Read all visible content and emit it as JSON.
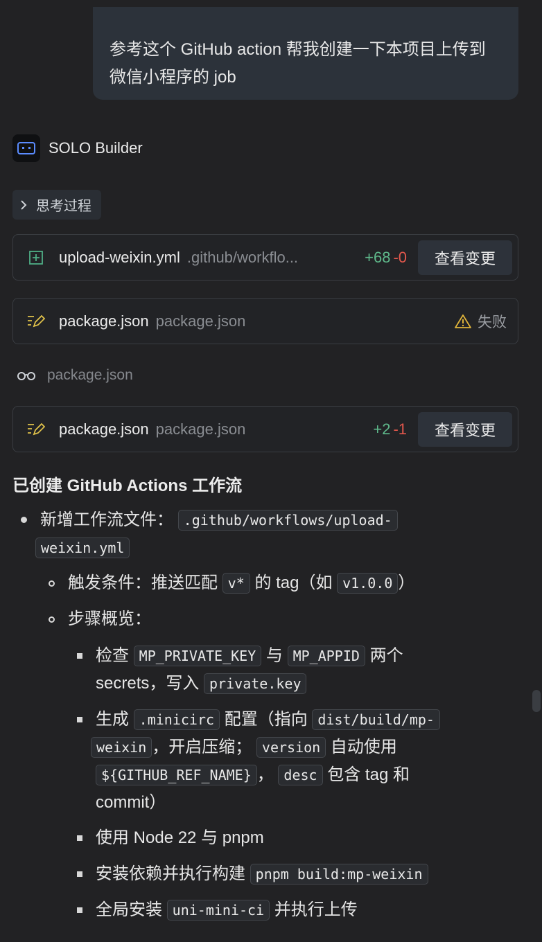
{
  "user_message": "参考这个 GitHub action 帮我创建一下本项目上传到微信小程序的 job",
  "agent": {
    "name": "SOLO Builder"
  },
  "thinking": {
    "label": "思考过程"
  },
  "file_cards": [
    {
      "name": "upload-weixin.yml",
      "path": ".github/workflo...",
      "added": "+68",
      "removed": "-0",
      "action": "查看变更",
      "icon": "file-plus-icon"
    },
    {
      "name": "package.json",
      "path": "package.json",
      "status": "失败",
      "icon": "file-edit-icon"
    },
    {
      "name": "package.json",
      "path": "package.json",
      "added": "+2",
      "removed": "-1",
      "action": "查看变更",
      "icon": "file-edit-icon"
    }
  ],
  "read_file": {
    "name": "package.json",
    "icon": "glasses-icon"
  },
  "summary": {
    "title": "已创建 GitHub Actions 工作流",
    "item1_label": "新增工作流文件：",
    "item1_code_a": ".github/workflows/upload-",
    "item1_code_b": "weixin.yml",
    "trigger_label": "触发条件：推送匹配",
    "trigger_code": "v*",
    "trigger_mid": "的 tag（如",
    "trigger_code2": "v1.0.0",
    "trigger_end": "）",
    "steps_label": "步骤概览：",
    "s1_a": "检查",
    "s1_code1": "MP_PRIVATE_KEY",
    "s1_b": "与",
    "s1_code2": "MP_APPID",
    "s1_c": "两个",
    "s1_d": "secrets，写入",
    "s1_code3": "private.key",
    "s2_a": "生成",
    "s2_code1": ".minicirc",
    "s2_b": "配置（指向",
    "s2_code2a": "dist/build/mp-",
    "s2_code2b": "weixin",
    "s2_c": "，开启压缩；",
    "s2_code3": "version",
    "s2_d": "自动使用",
    "s2_code4": "${GITHUB_REF_NAME}",
    "s2_e": "，",
    "s2_code5": "desc",
    "s2_f": "包含 tag 和",
    "s2_g": "commit）",
    "s3": "使用 Node 22 与 pnpm",
    "s4_a": "安装依赖并执行构建",
    "s4_code": "pnpm build:mp-weixin",
    "s5_a": "全局安装",
    "s5_code": "uni-mini-ci",
    "s5_b": "并执行上传"
  },
  "colors": {
    "added": "#5fb98b",
    "removed": "#e2574c",
    "warning": "#e0b43a",
    "edit_icon": "#e0c24a",
    "plus_icon": "#4fae86"
  }
}
